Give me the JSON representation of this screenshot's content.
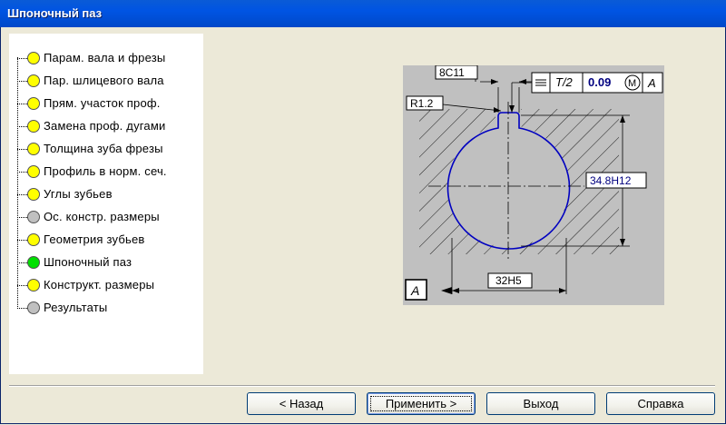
{
  "window": {
    "title": "Шпоночный паз"
  },
  "tree": {
    "items": [
      {
        "label": "Парам. вала и фрезы",
        "color": "#ffff00"
      },
      {
        "label": "Пар. шлицевого вала",
        "color": "#ffff00"
      },
      {
        "label": "Прям. участок проф.",
        "color": "#ffff00"
      },
      {
        "label": "Замена проф. дугами",
        "color": "#ffff00"
      },
      {
        "label": "Толщина зуба фрезы",
        "color": "#ffff00"
      },
      {
        "label": "Профиль в норм. сеч.",
        "color": "#ffff00"
      },
      {
        "label": "Углы зубьев",
        "color": "#ffff00"
      },
      {
        "label": "Ос. констр. размеры",
        "color": "#c0c0c0"
      },
      {
        "label": "Геометрия зубьев",
        "color": "#ffff00"
      },
      {
        "label": "Шпоночный паз",
        "color": "#00e000"
      },
      {
        "label": "Конструкт. размеры",
        "color": "#ffff00"
      },
      {
        "label": "Результаты",
        "color": "#c0c0c0"
      }
    ]
  },
  "diagram": {
    "width_label": "8C11",
    "radius_label": "R1.2",
    "tolerance_symbol": "T/2",
    "tolerance_value": "0.09",
    "tolerance_modifier": "M",
    "datum_ref": "A",
    "diameter_label": "34.8H12",
    "depth_label": "32H5",
    "datum_label": "A",
    "profile_color": "#0000c0",
    "value_color": "#000080"
  },
  "buttons": {
    "back": "< Назад",
    "apply": "Применить >",
    "exit": "Выход",
    "help": "Справка"
  }
}
